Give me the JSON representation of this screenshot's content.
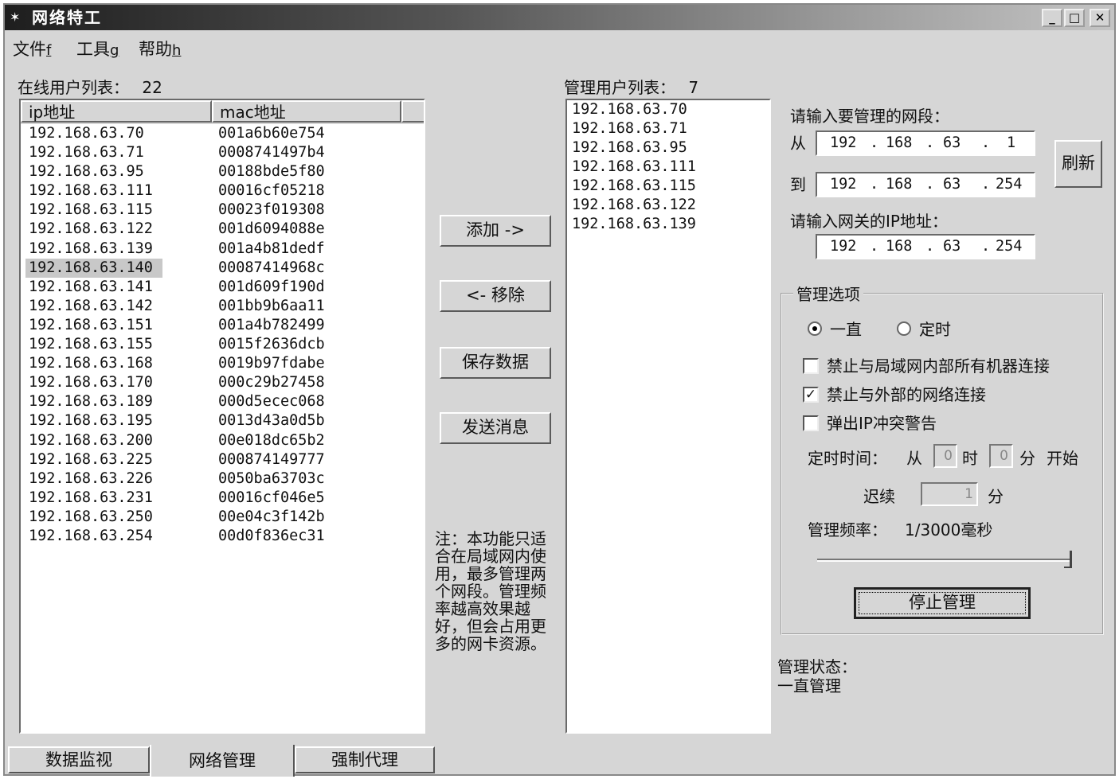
{
  "window": {
    "title": "网络特工",
    "app_icon": "spy-icon"
  },
  "menu": [
    {
      "label": "文件",
      "accel": "f"
    },
    {
      "label": "工具",
      "accel": "g"
    },
    {
      "label": "帮助",
      "accel": "h"
    }
  ],
  "online": {
    "label": "在线用户列表：",
    "count": "22",
    "columns": [
      "ip地址",
      "mac地址"
    ],
    "rows": [
      {
        "ip": "192.168.63.70",
        "mac": "001a6b60e754"
      },
      {
        "ip": "192.168.63.71",
        "mac": "0008741497b4"
      },
      {
        "ip": "192.168.63.95",
        "mac": "00188bde5f80"
      },
      {
        "ip": "192.168.63.111",
        "mac": "00016cf05218"
      },
      {
        "ip": "192.168.63.115",
        "mac": "00023f019308"
      },
      {
        "ip": "192.168.63.122",
        "mac": "001d6094088e"
      },
      {
        "ip": "192.168.63.139",
        "mac": "001a4b81dedf"
      },
      {
        "ip": "192.168.63.140",
        "mac": "00087414968c"
      },
      {
        "ip": "192.168.63.141",
        "mac": "001d609f190d"
      },
      {
        "ip": "192.168.63.142",
        "mac": "001bb9b6aa11"
      },
      {
        "ip": "192.168.63.151",
        "mac": "001a4b782499"
      },
      {
        "ip": "192.168.63.155",
        "mac": "0015f2636dcb"
      },
      {
        "ip": "192.168.63.168",
        "mac": "0019b97fdabe"
      },
      {
        "ip": "192.168.63.170",
        "mac": "000c29b27458"
      },
      {
        "ip": "192.168.63.189",
        "mac": "000d5ecec068"
      },
      {
        "ip": "192.168.63.195",
        "mac": "0013d43a0d5b"
      },
      {
        "ip": "192.168.63.200",
        "mac": "00e018dc65b2"
      },
      {
        "ip": "192.168.63.225",
        "mac": "000874149777"
      },
      {
        "ip": "192.168.63.226",
        "mac": "0050ba63703c"
      },
      {
        "ip": "192.168.63.231",
        "mac": "00016cf046e5"
      },
      {
        "ip": "192.168.63.250",
        "mac": "00e04c3f142b"
      },
      {
        "ip": "192.168.63.254",
        "mac": "00d0f836ec31"
      }
    ],
    "selected_index": 7
  },
  "buttons": {
    "add": "添加 ->",
    "remove": "<- 移除",
    "save": "保存数据",
    "send": "发送消息",
    "refresh": "刷新",
    "stop": "停止管理"
  },
  "note": "注：本功能只适合在局域网内使用，最多管理两个网段。管理频率越高效果越好，但会占用更多的网卡资源。",
  "managed": {
    "label": "管理用户列表：",
    "count": "7",
    "rows": [
      "192.168.63.70",
      "192.168.63.71",
      "192.168.63.95",
      "192.168.63.111",
      "192.168.63.115",
      "192.168.63.122",
      "192.168.63.139"
    ]
  },
  "range": {
    "prompt": "请输入要管理的网段：",
    "from_label": "从",
    "to_label": "到",
    "from": [
      "192",
      "168",
      "63",
      "1"
    ],
    "to": [
      "192",
      "168",
      "63",
      "254"
    ]
  },
  "gateway": {
    "prompt": "请输入网关的IP地址：",
    "ip": [
      "192",
      "168",
      "63",
      "254"
    ]
  },
  "options": {
    "title": "管理选项",
    "radio_always": "一直",
    "radio_timed": "定时",
    "radio_selected": "always",
    "check_lan": "禁止与局域网内部所有机器连接",
    "check_lan_checked": false,
    "check_ext": "禁止与外部的网络连接",
    "check_ext_checked": true,
    "check_ip": "弹出IP冲突警告",
    "check_ip_checked": false,
    "timer_label": "定时时间：",
    "timer_from": "从",
    "hour_value": "0",
    "hour_unit": "时",
    "min_value": "0",
    "min_unit": "分",
    "start": "开始",
    "duration_label": "迟续",
    "duration_value": "1",
    "duration_unit": "分",
    "freq_label": "管理频率：",
    "freq_value": "1/3000毫秒",
    "freq_slider_level": 1.0
  },
  "status": {
    "label": "管理状态：",
    "value": "一直管理"
  },
  "tabs": [
    "数据监视",
    "网络管理",
    "强制代理"
  ],
  "active_tab": 1
}
